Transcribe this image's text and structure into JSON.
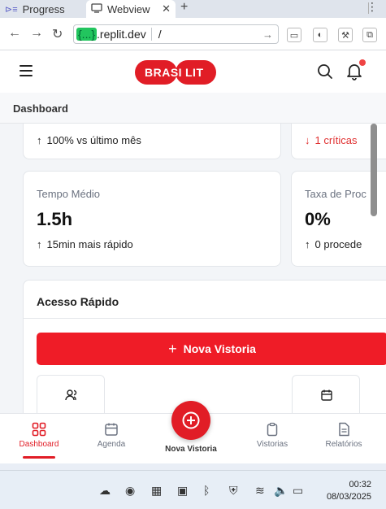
{
  "browser": {
    "tabs": [
      {
        "label": "Progress",
        "icon": "progress-icon"
      },
      {
        "label": "Webview",
        "icon": "webview-icon",
        "active": true
      }
    ],
    "url": {
      "host_highlight": "{...}",
      "host_rest": ".replit.dev",
      "path": "/"
    }
  },
  "app": {
    "brand": {
      "part1": "BRASI",
      "part2": "LIT",
      "color": "#e11d26"
    },
    "breadcrumb": "Dashboard",
    "stats_top": [
      {
        "note": "100% vs último mês",
        "trend": "up"
      },
      {
        "note": "1 críticas",
        "trend": "down",
        "color": "#e03131"
      }
    ],
    "stats": [
      {
        "label": "Tempo Médio",
        "value": "1.5h",
        "note": "15min mais rápido",
        "trend": "up"
      },
      {
        "label": "Taxa de Proc",
        "value": "0%",
        "note": "0 procede",
        "trend": "up"
      }
    ],
    "quick_access": {
      "title": "Acesso Rápido",
      "primary_button": "Nova Vistoria",
      "tiles": [
        {
          "icon": "users-icon"
        },
        {
          "icon": "calendar-icon"
        }
      ]
    },
    "bottom_nav": [
      {
        "label": "Dashboard",
        "icon": "dashboard-icon",
        "active": true
      },
      {
        "label": "Agenda",
        "icon": "calendar-icon"
      },
      {
        "label": "Nova Vistoria",
        "icon": "plus-icon"
      },
      {
        "label": "Vistorias",
        "icon": "clipboard-icon"
      },
      {
        "label": "Relatórios",
        "icon": "file-icon"
      }
    ]
  },
  "taskbar": {
    "time": "00:32",
    "date": "08/03/2025"
  }
}
